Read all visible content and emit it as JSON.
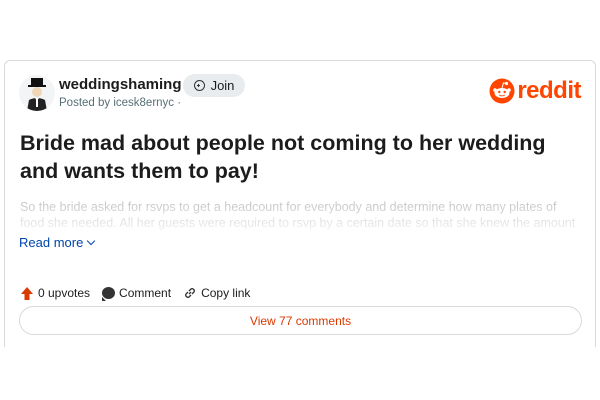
{
  "post": {
    "subreddit": "weddingshaming",
    "posted_by": "Posted by icesk8ernyc ·",
    "join_label": "Join",
    "brand": "reddit",
    "title": "Bride mad about people not coming to her wedding and wants them to pay!",
    "body_preview": "So the bride asked for rsvps to get a headcount for everybody and determine how many plates of food she needed. All her guests were required to rsvp by a certain date so that she knew the amount to pay",
    "read_more_label": "Read more",
    "upvotes_label": "0 upvotes",
    "comment_label": "Comment",
    "copy_link_label": "Copy link",
    "view_comments_label": "View 77 comments"
  },
  "colors": {
    "brand_orange": "#ff4500",
    "link_blue": "#0045ac",
    "view_comments_text": "#d93a00",
    "upvote_red": "#d93a00"
  },
  "icons": {
    "join": "plus-circle-icon",
    "upvote": "upvote-arrow-icon",
    "comment": "comment-bubble-icon",
    "copy_link": "link-chain-icon",
    "read_more": "chevron-down-icon",
    "logo": "reddit-snoo-icon"
  }
}
